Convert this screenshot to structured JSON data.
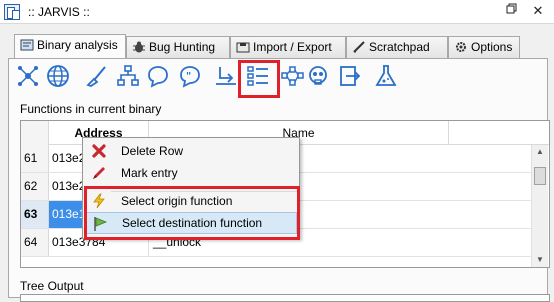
{
  "window": {
    "title": ":: JARVIS ::"
  },
  "tabs": [
    {
      "label": "Binary analysis",
      "icon": "binary-analysis-icon",
      "active": true
    },
    {
      "label": "Bug Hunting",
      "icon": "bug-icon",
      "active": false
    },
    {
      "label": "Import / Export",
      "icon": "import-export-icon",
      "active": false
    },
    {
      "label": "Scratchpad",
      "icon": "scratchpad-icon",
      "active": false
    },
    {
      "label": "Options",
      "icon": "gear-icon",
      "active": false
    }
  ],
  "toolbar": [
    "network-icon",
    "globe-icon",
    "brush-icon",
    "tree-icon",
    "comment-icon",
    "quote-icon",
    "import-arrow-icon",
    "checklist-icon",
    "graph-icon",
    "skull-icon",
    "export-icon",
    "flask-icon"
  ],
  "functions": {
    "label": "Functions in current binary",
    "columns": {
      "address": "Address",
      "name": "Name"
    },
    "rows": [
      {
        "num": "61",
        "address": "013e24",
        "name": "",
        "selected": false
      },
      {
        "num": "62",
        "address": "013e2",
        "name": "",
        "selected": false
      },
      {
        "num": "63",
        "address": "013e1",
        "name": "",
        "selected": true
      },
      {
        "num": "64",
        "address": "013e3784",
        "name": "__unlock",
        "selected": false
      }
    ]
  },
  "tree_output": {
    "label": "Tree Output"
  },
  "context_menu": {
    "items": [
      {
        "label": "Delete Row",
        "icon": "delete-x-icon"
      },
      {
        "label": "Mark entry",
        "icon": "marker-icon"
      },
      {
        "label": "Select origin function",
        "icon": "lightning-icon"
      },
      {
        "label": "Select destination function",
        "icon": "flag-icon"
      }
    ]
  },
  "colors": {
    "highlight": "#e0202a",
    "selection": "#3d8ee8"
  }
}
